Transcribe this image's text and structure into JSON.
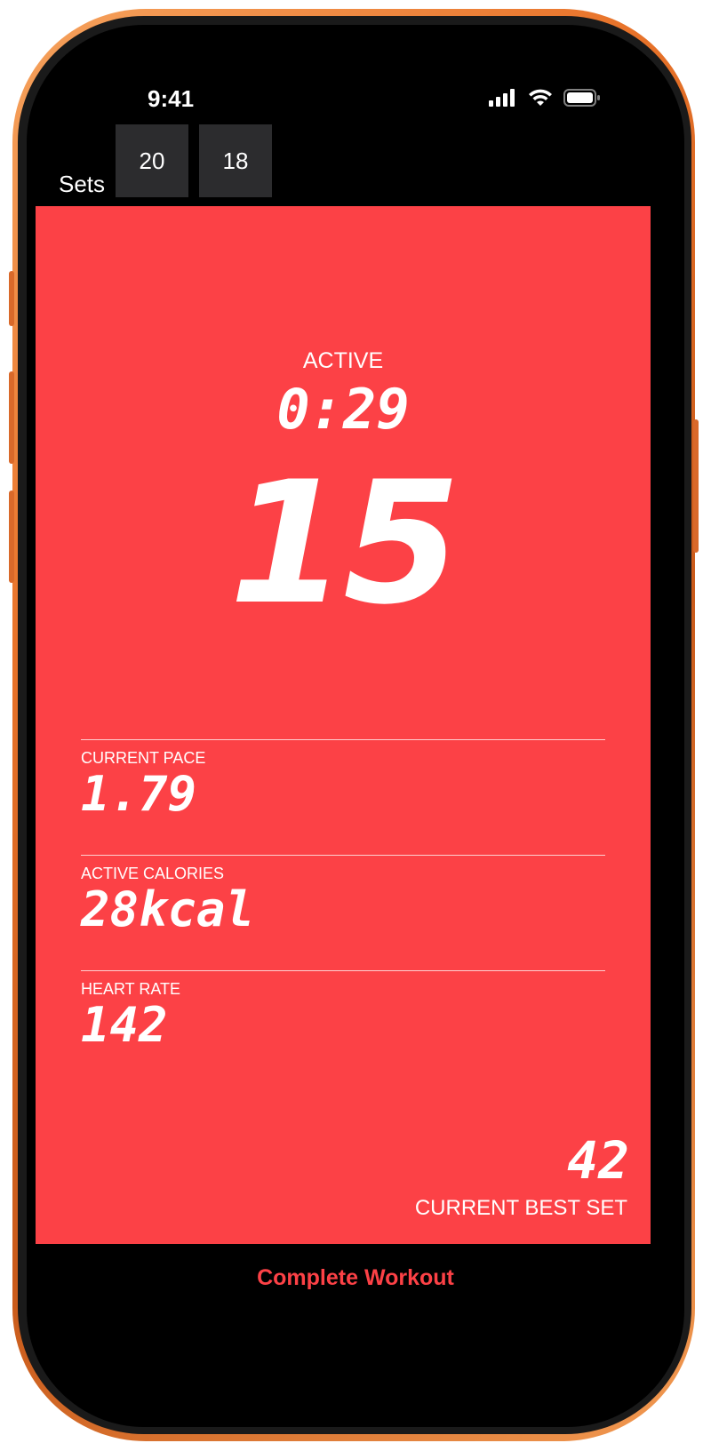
{
  "status_bar": {
    "time": "9:41",
    "icons": [
      "cellular-signal-icon",
      "wifi-icon",
      "battery-icon"
    ]
  },
  "sets": {
    "label": "Sets",
    "items": [
      "20",
      "18"
    ]
  },
  "workout": {
    "state_label": "ACTIVE",
    "elapsed": "0:29",
    "rep_count": "15"
  },
  "metrics": [
    {
      "label": "CURRENT PACE",
      "value": "1.79"
    },
    {
      "label": "ACTIVE CALORIES",
      "value": "28kcal"
    },
    {
      "label": "HEART RATE",
      "value": "142"
    }
  ],
  "best_set": {
    "value": "42",
    "label": "CURRENT BEST SET"
  },
  "actions": {
    "complete_label": "Complete Workout"
  },
  "colors": {
    "accent_red": "#fc4146",
    "chip_bg": "#2c2c2e",
    "frame_orange": "#e8732a"
  }
}
